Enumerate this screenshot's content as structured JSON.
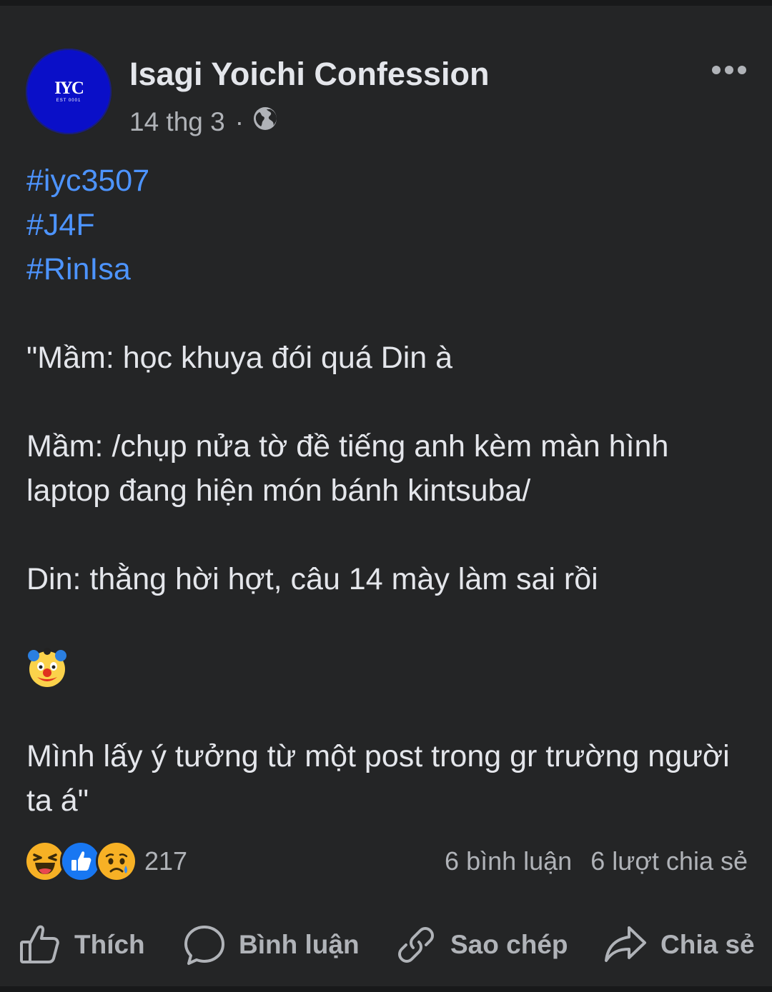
{
  "post": {
    "page_name": "Isagi Yoichi Confession",
    "avatar": {
      "abbr": "IYC",
      "est": "EST 0001",
      "color": "#0a0fc8"
    },
    "date": "14 thg 3",
    "separator": "·",
    "privacy_icon": "globe-icon",
    "more_icon": "more-horizontal-icon",
    "hashtags": [
      "#iyc3507",
      "#J4F",
      "#RinIsa"
    ],
    "lines": {
      "l1": "\"Mầm: học khuya đói quá Din à",
      "l2": "Mầm: /chụp nửa tờ đề tiếng anh kèm màn hình laptop đang hiện món bánh kintsuba/",
      "l3": "Din: thằng hời hợt, câu 14 mày làm sai rồi",
      "emoji": "clown-face-emoji",
      "l4": "Mình lấy ý tưởng từ một post trong gr trường người ta á\""
    }
  },
  "stats": {
    "reactions": [
      "haha-reaction-icon",
      "like-reaction-icon",
      "sad-reaction-icon"
    ],
    "reaction_count": "217",
    "comments": "6 bình luận",
    "shares": "6 lượt chia sẻ"
  },
  "actions": {
    "like": "Thích",
    "comment": "Bình luận",
    "copy": "Sao chép",
    "share": "Chia sẻ"
  },
  "colors": {
    "background": "#18191a",
    "card": "#242526",
    "text": "#e4e6eb",
    "secondary_text": "#b0b3b8",
    "hashtag": "#4d94ff",
    "like_blue": "#1877f2"
  }
}
